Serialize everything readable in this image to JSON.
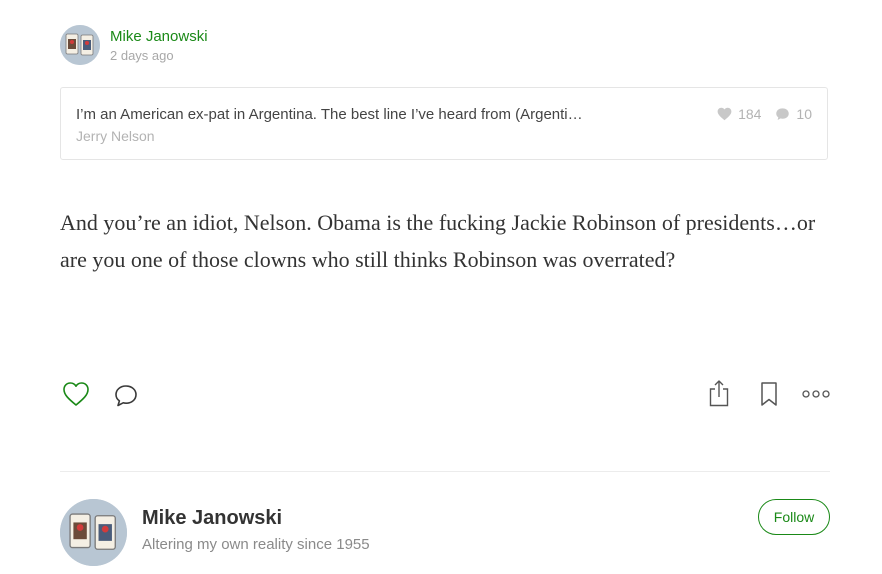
{
  "response": {
    "author_name": "Mike Janowski",
    "timestamp": "2 days ago",
    "body": "And you’re an idiot, Nelson. Obama is the fucking Jackie Robinson of presidents…or are you one of those clowns who still thinks Robinson was overrated?"
  },
  "quoted_post": {
    "snippet": "I’m an American ex-pat in Argentina. The best line I’ve heard from (Argenti…",
    "author": "Jerry Nelson",
    "claps": "184",
    "responses": "10"
  },
  "actions": {
    "like_icon": "heart-outline-icon",
    "respond_icon": "speech-bubble-icon",
    "share_icon": "share-icon",
    "bookmark_icon": "bookmark-icon",
    "more_icon": "more-horizontal-icon"
  },
  "author_bio": {
    "name": "Mike Janowski",
    "bio": "Altering my own reality since 1955",
    "follow_label": "Follow"
  },
  "colors": {
    "accent": "#1a8917",
    "text": "#333333",
    "muted": "#a8a8a8"
  }
}
